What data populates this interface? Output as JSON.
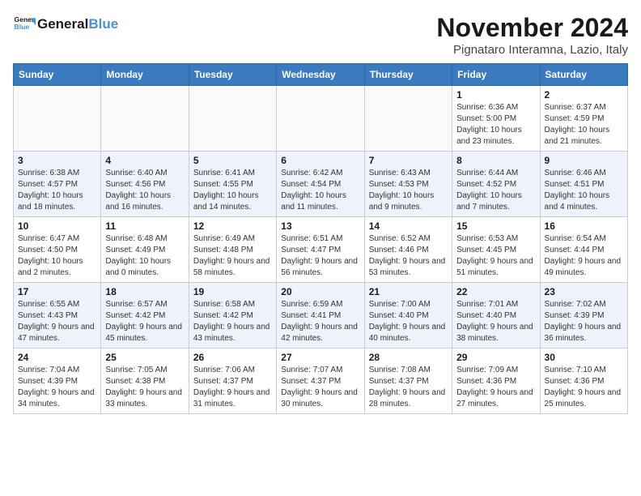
{
  "header": {
    "logo_line1": "General",
    "logo_line2": "Blue",
    "month_title": "November 2024",
    "location": "Pignataro Interamna, Lazio, Italy"
  },
  "weekdays": [
    "Sunday",
    "Monday",
    "Tuesday",
    "Wednesday",
    "Thursday",
    "Friday",
    "Saturday"
  ],
  "weeks": [
    [
      {
        "day": "",
        "detail": ""
      },
      {
        "day": "",
        "detail": ""
      },
      {
        "day": "",
        "detail": ""
      },
      {
        "day": "",
        "detail": ""
      },
      {
        "day": "",
        "detail": ""
      },
      {
        "day": "1",
        "detail": "Sunrise: 6:36 AM\nSunset: 5:00 PM\nDaylight: 10 hours and 23 minutes."
      },
      {
        "day": "2",
        "detail": "Sunrise: 6:37 AM\nSunset: 4:59 PM\nDaylight: 10 hours and 21 minutes."
      }
    ],
    [
      {
        "day": "3",
        "detail": "Sunrise: 6:38 AM\nSunset: 4:57 PM\nDaylight: 10 hours and 18 minutes."
      },
      {
        "day": "4",
        "detail": "Sunrise: 6:40 AM\nSunset: 4:56 PM\nDaylight: 10 hours and 16 minutes."
      },
      {
        "day": "5",
        "detail": "Sunrise: 6:41 AM\nSunset: 4:55 PM\nDaylight: 10 hours and 14 minutes."
      },
      {
        "day": "6",
        "detail": "Sunrise: 6:42 AM\nSunset: 4:54 PM\nDaylight: 10 hours and 11 minutes."
      },
      {
        "day": "7",
        "detail": "Sunrise: 6:43 AM\nSunset: 4:53 PM\nDaylight: 10 hours and 9 minutes."
      },
      {
        "day": "8",
        "detail": "Sunrise: 6:44 AM\nSunset: 4:52 PM\nDaylight: 10 hours and 7 minutes."
      },
      {
        "day": "9",
        "detail": "Sunrise: 6:46 AM\nSunset: 4:51 PM\nDaylight: 10 hours and 4 minutes."
      }
    ],
    [
      {
        "day": "10",
        "detail": "Sunrise: 6:47 AM\nSunset: 4:50 PM\nDaylight: 10 hours and 2 minutes."
      },
      {
        "day": "11",
        "detail": "Sunrise: 6:48 AM\nSunset: 4:49 PM\nDaylight: 10 hours and 0 minutes."
      },
      {
        "day": "12",
        "detail": "Sunrise: 6:49 AM\nSunset: 4:48 PM\nDaylight: 9 hours and 58 minutes."
      },
      {
        "day": "13",
        "detail": "Sunrise: 6:51 AM\nSunset: 4:47 PM\nDaylight: 9 hours and 56 minutes."
      },
      {
        "day": "14",
        "detail": "Sunrise: 6:52 AM\nSunset: 4:46 PM\nDaylight: 9 hours and 53 minutes."
      },
      {
        "day": "15",
        "detail": "Sunrise: 6:53 AM\nSunset: 4:45 PM\nDaylight: 9 hours and 51 minutes."
      },
      {
        "day": "16",
        "detail": "Sunrise: 6:54 AM\nSunset: 4:44 PM\nDaylight: 9 hours and 49 minutes."
      }
    ],
    [
      {
        "day": "17",
        "detail": "Sunrise: 6:55 AM\nSunset: 4:43 PM\nDaylight: 9 hours and 47 minutes."
      },
      {
        "day": "18",
        "detail": "Sunrise: 6:57 AM\nSunset: 4:42 PM\nDaylight: 9 hours and 45 minutes."
      },
      {
        "day": "19",
        "detail": "Sunrise: 6:58 AM\nSunset: 4:42 PM\nDaylight: 9 hours and 43 minutes."
      },
      {
        "day": "20",
        "detail": "Sunrise: 6:59 AM\nSunset: 4:41 PM\nDaylight: 9 hours and 42 minutes."
      },
      {
        "day": "21",
        "detail": "Sunrise: 7:00 AM\nSunset: 4:40 PM\nDaylight: 9 hours and 40 minutes."
      },
      {
        "day": "22",
        "detail": "Sunrise: 7:01 AM\nSunset: 4:40 PM\nDaylight: 9 hours and 38 minutes."
      },
      {
        "day": "23",
        "detail": "Sunrise: 7:02 AM\nSunset: 4:39 PM\nDaylight: 9 hours and 36 minutes."
      }
    ],
    [
      {
        "day": "24",
        "detail": "Sunrise: 7:04 AM\nSunset: 4:39 PM\nDaylight: 9 hours and 34 minutes."
      },
      {
        "day": "25",
        "detail": "Sunrise: 7:05 AM\nSunset: 4:38 PM\nDaylight: 9 hours and 33 minutes."
      },
      {
        "day": "26",
        "detail": "Sunrise: 7:06 AM\nSunset: 4:37 PM\nDaylight: 9 hours and 31 minutes."
      },
      {
        "day": "27",
        "detail": "Sunrise: 7:07 AM\nSunset: 4:37 PM\nDaylight: 9 hours and 30 minutes."
      },
      {
        "day": "28",
        "detail": "Sunrise: 7:08 AM\nSunset: 4:37 PM\nDaylight: 9 hours and 28 minutes."
      },
      {
        "day": "29",
        "detail": "Sunrise: 7:09 AM\nSunset: 4:36 PM\nDaylight: 9 hours and 27 minutes."
      },
      {
        "day": "30",
        "detail": "Sunrise: 7:10 AM\nSunset: 4:36 PM\nDaylight: 9 hours and 25 minutes."
      }
    ]
  ]
}
